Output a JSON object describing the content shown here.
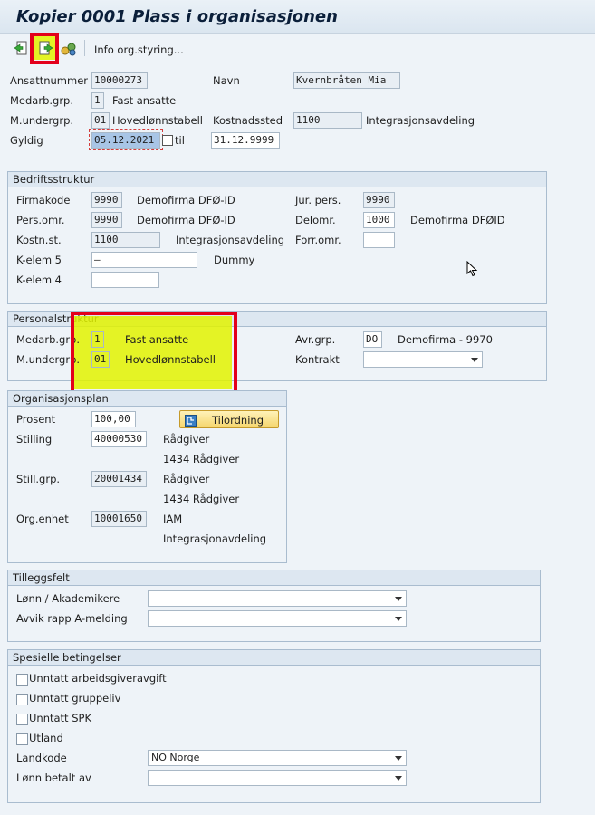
{
  "window": {
    "title": "Kopier 0001 Plass i organisasjonen"
  },
  "toolbar": {
    "info_label": "Info org.styring..."
  },
  "header": {
    "ansattnummer_label": "Ansattnummer",
    "ansattnummer_value": "10000273",
    "navn_label": "Navn",
    "navn_value": "Kvernbråten Mia",
    "medarb_label": "Medarb.grp.",
    "medarb_code": "1",
    "medarb_text": "Fast ansatte",
    "mundergrp_label": "M.undergrp.",
    "mundergrp_code": "01",
    "mundergrp_text": "Hovedlønnstabell",
    "kostnadssted_label": "Kostnadssted",
    "kostnadssted_code": "1100",
    "kostnadssted_text": "Integrasjonsavdeling",
    "gyldig_label": "Gyldig",
    "gyldig_from": "05.12.2021",
    "til_label": "til",
    "gyldig_to": "31.12.9999"
  },
  "bedrift": {
    "title": "Bedriftsstruktur",
    "firmakode_label": "Firmakode",
    "firmakode_code": "9990",
    "firmakode_text": "Demofirma DFØ-ID",
    "jurpers_label": "Jur. pers.",
    "jurpers_code": "9990",
    "persomr_label": "Pers.omr.",
    "persomr_code": "9990",
    "persomr_text": "Demofirma DFØ-ID",
    "delomr_label": "Delomr.",
    "delomr_code": "1000",
    "delomr_text": "Demofirma DFØID",
    "kostnst_label": "Kostn.st.",
    "kostnst_code": "1100",
    "kostnst_text": "Integrasjonsavdeling",
    "forromr_label": "Forr.omr.",
    "forromr_value": "",
    "kelem5_label": "K-elem 5",
    "kelem5_value": "–",
    "kelem5_text": "Dummy",
    "kelem4_label": "K-elem 4",
    "kelem4_value": ""
  },
  "personal": {
    "title": "Personalstruktur",
    "medarb_label": "Medarb.grp.",
    "medarb_code": "1",
    "medarb_text": "Fast ansatte",
    "mundergrp_label": "M.undergrp.",
    "mundergrp_code": "01",
    "mundergrp_text": "Hovedlønnstabell",
    "avrgrp_label": "Avr.grp.",
    "avrgrp_code": "DO",
    "avrgrp_text": "Demofirma - 9970",
    "kontrakt_label": "Kontrakt",
    "kontrakt_value": ""
  },
  "orgplan": {
    "title": "Organisasjonsplan",
    "prosent_label": "Prosent",
    "prosent_value": "100,00",
    "tilordning_label": "Tilordning",
    "stilling_label": "Stilling",
    "stilling_code": "40000530",
    "stilling_text1": "Rådgiver",
    "stilling_text2": "1434 Rådgiver",
    "stillgrp_label": "Still.grp.",
    "stillgrp_code": "20001434",
    "stillgrp_text1": "Rådgiver",
    "stillgrp_text2": "1434 Rådgiver",
    "orgenhet_label": "Org.enhet",
    "orgenhet_code": "10001650",
    "orgenhet_text1": "IAM",
    "orgenhet_text2": "Integrasjonavdeling"
  },
  "tillegg": {
    "title": "Tilleggsfelt",
    "lonn_label": "Lønn / Akademikere",
    "lonn_value": "",
    "avvik_label": "Avvik rapp A-melding",
    "avvik_value": ""
  },
  "spesielle": {
    "title": "Spesielle betingelser",
    "cb1": "Unntatt arbeidsgiveravgift",
    "cb2": "Unntatt gruppeliv",
    "cb3": "Unntatt SPK",
    "cb4": "Utland",
    "landkode_label": "Landkode",
    "landkode_value": "NO Norge",
    "lonnbetalt_label": "Lønn betalt av",
    "lonnbetalt_value": ""
  }
}
